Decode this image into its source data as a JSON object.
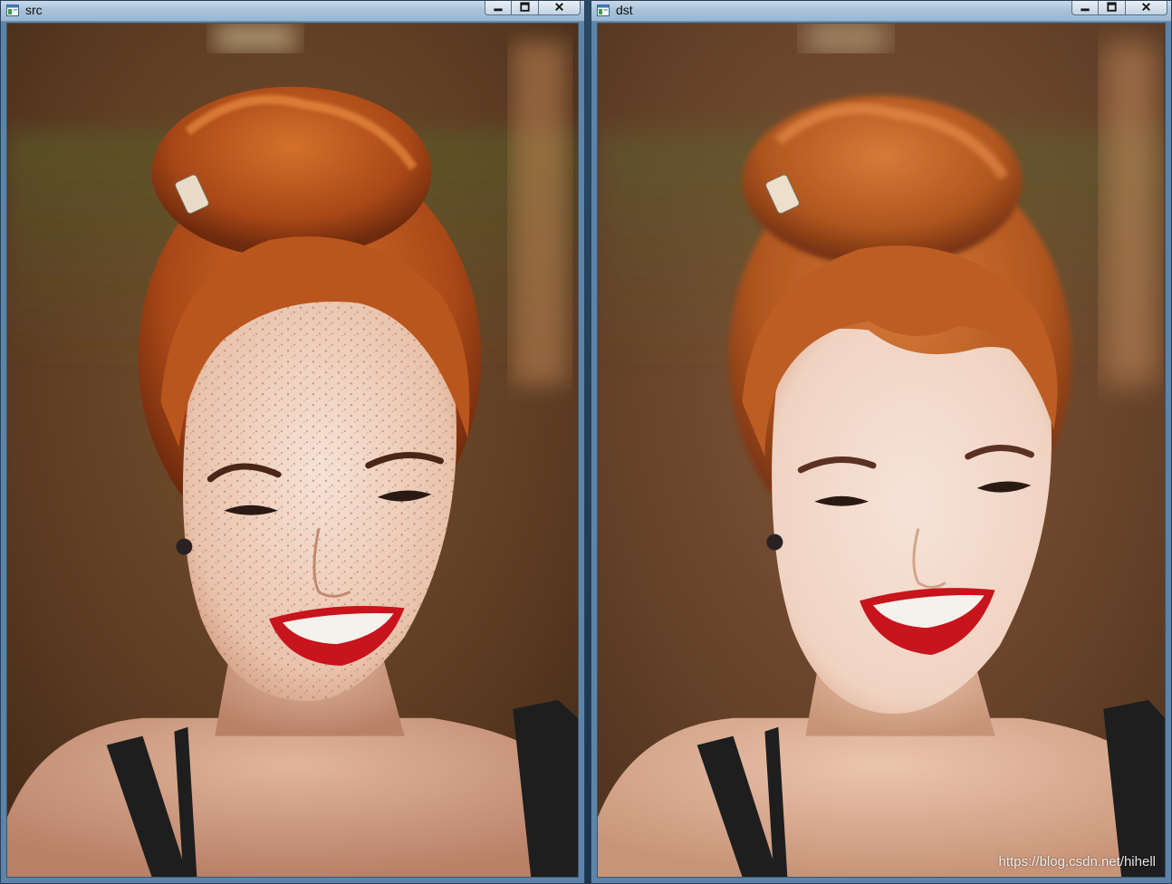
{
  "windows": [
    {
      "id": "src",
      "title": "src"
    },
    {
      "id": "dst",
      "title": "dst"
    }
  ],
  "watermark": "https://blog.csdn.net/hihell",
  "colors": {
    "titlebar": "#b4cade",
    "frame": "#5d84a8",
    "background_blur": "#6b4528",
    "hair": "#b3521c",
    "skin": "#f2d9c9",
    "lips": "#c8141c",
    "top": "#1e1e1e"
  },
  "icons": {
    "window": "app-window-icon",
    "minimize": "minimize-icon",
    "maximize": "maximize-icon",
    "close": "close-icon"
  }
}
